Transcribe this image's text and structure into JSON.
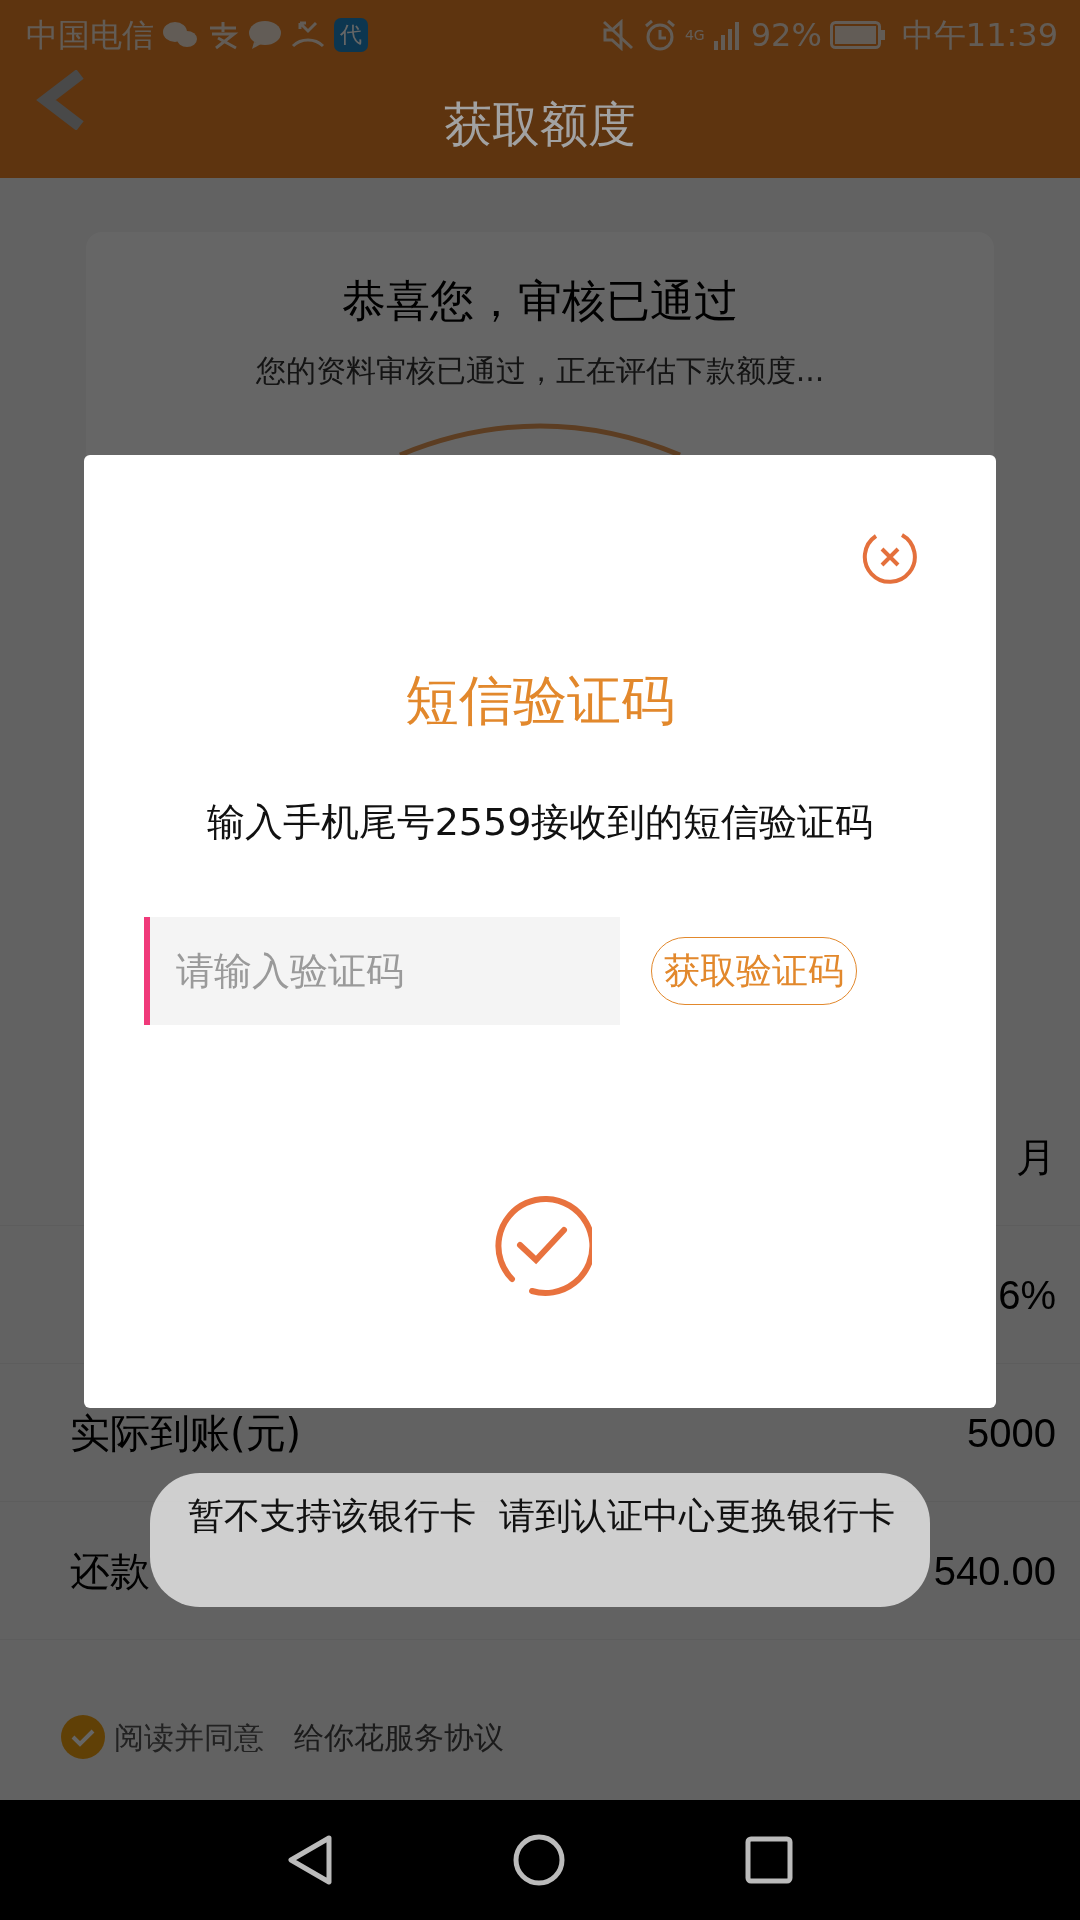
{
  "status_bar": {
    "carrier": "中国电信",
    "app_badge": "代",
    "network": "4G",
    "battery": "92%",
    "time": "中午11:39"
  },
  "header": {
    "title": "获取额度"
  },
  "card": {
    "title": "恭喜您，审核已通过",
    "subtitle": "您的资料审核已通过，正在评估下款额度..."
  },
  "rows": [
    {
      "value": "月"
    },
    {
      "value": "6%"
    },
    {
      "label": "实际到账(元)",
      "value": "5000"
    },
    {
      "label": "还款",
      "value": "540.00"
    }
  ],
  "agreement": {
    "checked": true,
    "text": "阅读并同意",
    "link": "给你花服务协议"
  },
  "dialog": {
    "title": "短信验证码",
    "message": "输入手机尾号2559接收到的短信验证码",
    "code_field": {
      "placeholder": "请输入验证码"
    },
    "send_button": "获取验证码"
  },
  "toast": {
    "text": "暂不支持该银行卡  请到认证中心更换银行卡"
  }
}
